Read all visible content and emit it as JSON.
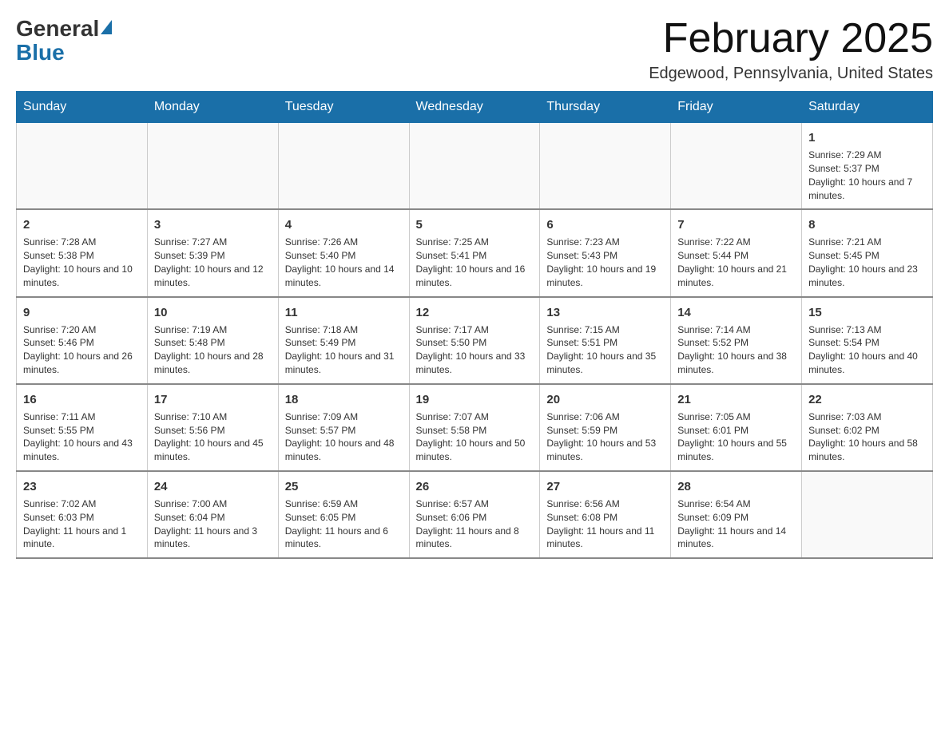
{
  "header": {
    "logo_general": "General",
    "logo_blue": "Blue",
    "month_title": "February 2025",
    "location": "Edgewood, Pennsylvania, United States"
  },
  "days_of_week": [
    "Sunday",
    "Monday",
    "Tuesday",
    "Wednesday",
    "Thursday",
    "Friday",
    "Saturday"
  ],
  "weeks": [
    [
      {
        "day": "",
        "info": ""
      },
      {
        "day": "",
        "info": ""
      },
      {
        "day": "",
        "info": ""
      },
      {
        "day": "",
        "info": ""
      },
      {
        "day": "",
        "info": ""
      },
      {
        "day": "",
        "info": ""
      },
      {
        "day": "1",
        "info": "Sunrise: 7:29 AM\nSunset: 5:37 PM\nDaylight: 10 hours and 7 minutes."
      }
    ],
    [
      {
        "day": "2",
        "info": "Sunrise: 7:28 AM\nSunset: 5:38 PM\nDaylight: 10 hours and 10 minutes."
      },
      {
        "day": "3",
        "info": "Sunrise: 7:27 AM\nSunset: 5:39 PM\nDaylight: 10 hours and 12 minutes."
      },
      {
        "day": "4",
        "info": "Sunrise: 7:26 AM\nSunset: 5:40 PM\nDaylight: 10 hours and 14 minutes."
      },
      {
        "day": "5",
        "info": "Sunrise: 7:25 AM\nSunset: 5:41 PM\nDaylight: 10 hours and 16 minutes."
      },
      {
        "day": "6",
        "info": "Sunrise: 7:23 AM\nSunset: 5:43 PM\nDaylight: 10 hours and 19 minutes."
      },
      {
        "day": "7",
        "info": "Sunrise: 7:22 AM\nSunset: 5:44 PM\nDaylight: 10 hours and 21 minutes."
      },
      {
        "day": "8",
        "info": "Sunrise: 7:21 AM\nSunset: 5:45 PM\nDaylight: 10 hours and 23 minutes."
      }
    ],
    [
      {
        "day": "9",
        "info": "Sunrise: 7:20 AM\nSunset: 5:46 PM\nDaylight: 10 hours and 26 minutes."
      },
      {
        "day": "10",
        "info": "Sunrise: 7:19 AM\nSunset: 5:48 PM\nDaylight: 10 hours and 28 minutes."
      },
      {
        "day": "11",
        "info": "Sunrise: 7:18 AM\nSunset: 5:49 PM\nDaylight: 10 hours and 31 minutes."
      },
      {
        "day": "12",
        "info": "Sunrise: 7:17 AM\nSunset: 5:50 PM\nDaylight: 10 hours and 33 minutes."
      },
      {
        "day": "13",
        "info": "Sunrise: 7:15 AM\nSunset: 5:51 PM\nDaylight: 10 hours and 35 minutes."
      },
      {
        "day": "14",
        "info": "Sunrise: 7:14 AM\nSunset: 5:52 PM\nDaylight: 10 hours and 38 minutes."
      },
      {
        "day": "15",
        "info": "Sunrise: 7:13 AM\nSunset: 5:54 PM\nDaylight: 10 hours and 40 minutes."
      }
    ],
    [
      {
        "day": "16",
        "info": "Sunrise: 7:11 AM\nSunset: 5:55 PM\nDaylight: 10 hours and 43 minutes."
      },
      {
        "day": "17",
        "info": "Sunrise: 7:10 AM\nSunset: 5:56 PM\nDaylight: 10 hours and 45 minutes."
      },
      {
        "day": "18",
        "info": "Sunrise: 7:09 AM\nSunset: 5:57 PM\nDaylight: 10 hours and 48 minutes."
      },
      {
        "day": "19",
        "info": "Sunrise: 7:07 AM\nSunset: 5:58 PM\nDaylight: 10 hours and 50 minutes."
      },
      {
        "day": "20",
        "info": "Sunrise: 7:06 AM\nSunset: 5:59 PM\nDaylight: 10 hours and 53 minutes."
      },
      {
        "day": "21",
        "info": "Sunrise: 7:05 AM\nSunset: 6:01 PM\nDaylight: 10 hours and 55 minutes."
      },
      {
        "day": "22",
        "info": "Sunrise: 7:03 AM\nSunset: 6:02 PM\nDaylight: 10 hours and 58 minutes."
      }
    ],
    [
      {
        "day": "23",
        "info": "Sunrise: 7:02 AM\nSunset: 6:03 PM\nDaylight: 11 hours and 1 minute."
      },
      {
        "day": "24",
        "info": "Sunrise: 7:00 AM\nSunset: 6:04 PM\nDaylight: 11 hours and 3 minutes."
      },
      {
        "day": "25",
        "info": "Sunrise: 6:59 AM\nSunset: 6:05 PM\nDaylight: 11 hours and 6 minutes."
      },
      {
        "day": "26",
        "info": "Sunrise: 6:57 AM\nSunset: 6:06 PM\nDaylight: 11 hours and 8 minutes."
      },
      {
        "day": "27",
        "info": "Sunrise: 6:56 AM\nSunset: 6:08 PM\nDaylight: 11 hours and 11 minutes."
      },
      {
        "day": "28",
        "info": "Sunrise: 6:54 AM\nSunset: 6:09 PM\nDaylight: 11 hours and 14 minutes."
      },
      {
        "day": "",
        "info": ""
      }
    ]
  ]
}
